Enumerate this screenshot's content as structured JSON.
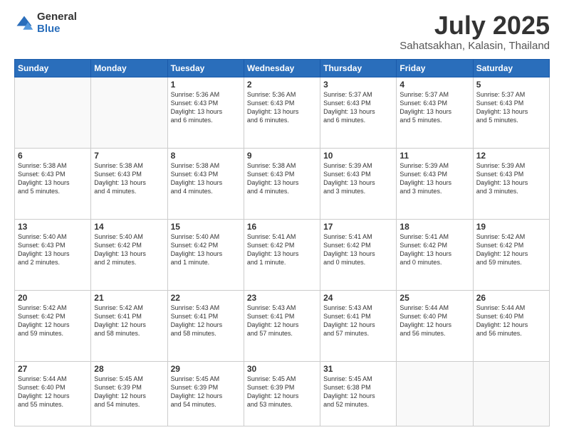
{
  "header": {
    "logo_general": "General",
    "logo_blue": "Blue",
    "title": "July 2025",
    "location": "Sahatsakhan, Kalasin, Thailand"
  },
  "weekdays": [
    "Sunday",
    "Monday",
    "Tuesday",
    "Wednesday",
    "Thursday",
    "Friday",
    "Saturday"
  ],
  "weeks": [
    [
      {
        "day": "",
        "text": ""
      },
      {
        "day": "",
        "text": ""
      },
      {
        "day": "1",
        "text": "Sunrise: 5:36 AM\nSunset: 6:43 PM\nDaylight: 13 hours\nand 6 minutes."
      },
      {
        "day": "2",
        "text": "Sunrise: 5:36 AM\nSunset: 6:43 PM\nDaylight: 13 hours\nand 6 minutes."
      },
      {
        "day": "3",
        "text": "Sunrise: 5:37 AM\nSunset: 6:43 PM\nDaylight: 13 hours\nand 6 minutes."
      },
      {
        "day": "4",
        "text": "Sunrise: 5:37 AM\nSunset: 6:43 PM\nDaylight: 13 hours\nand 5 minutes."
      },
      {
        "day": "5",
        "text": "Sunrise: 5:37 AM\nSunset: 6:43 PM\nDaylight: 13 hours\nand 5 minutes."
      }
    ],
    [
      {
        "day": "6",
        "text": "Sunrise: 5:38 AM\nSunset: 6:43 PM\nDaylight: 13 hours\nand 5 minutes."
      },
      {
        "day": "7",
        "text": "Sunrise: 5:38 AM\nSunset: 6:43 PM\nDaylight: 13 hours\nand 4 minutes."
      },
      {
        "day": "8",
        "text": "Sunrise: 5:38 AM\nSunset: 6:43 PM\nDaylight: 13 hours\nand 4 minutes."
      },
      {
        "day": "9",
        "text": "Sunrise: 5:38 AM\nSunset: 6:43 PM\nDaylight: 13 hours\nand 4 minutes."
      },
      {
        "day": "10",
        "text": "Sunrise: 5:39 AM\nSunset: 6:43 PM\nDaylight: 13 hours\nand 3 minutes."
      },
      {
        "day": "11",
        "text": "Sunrise: 5:39 AM\nSunset: 6:43 PM\nDaylight: 13 hours\nand 3 minutes."
      },
      {
        "day": "12",
        "text": "Sunrise: 5:39 AM\nSunset: 6:43 PM\nDaylight: 13 hours\nand 3 minutes."
      }
    ],
    [
      {
        "day": "13",
        "text": "Sunrise: 5:40 AM\nSunset: 6:43 PM\nDaylight: 13 hours\nand 2 minutes."
      },
      {
        "day": "14",
        "text": "Sunrise: 5:40 AM\nSunset: 6:42 PM\nDaylight: 13 hours\nand 2 minutes."
      },
      {
        "day": "15",
        "text": "Sunrise: 5:40 AM\nSunset: 6:42 PM\nDaylight: 13 hours\nand 1 minute."
      },
      {
        "day": "16",
        "text": "Sunrise: 5:41 AM\nSunset: 6:42 PM\nDaylight: 13 hours\nand 1 minute."
      },
      {
        "day": "17",
        "text": "Sunrise: 5:41 AM\nSunset: 6:42 PM\nDaylight: 13 hours\nand 0 minutes."
      },
      {
        "day": "18",
        "text": "Sunrise: 5:41 AM\nSunset: 6:42 PM\nDaylight: 13 hours\nand 0 minutes."
      },
      {
        "day": "19",
        "text": "Sunrise: 5:42 AM\nSunset: 6:42 PM\nDaylight: 12 hours\nand 59 minutes."
      }
    ],
    [
      {
        "day": "20",
        "text": "Sunrise: 5:42 AM\nSunset: 6:42 PM\nDaylight: 12 hours\nand 59 minutes."
      },
      {
        "day": "21",
        "text": "Sunrise: 5:42 AM\nSunset: 6:41 PM\nDaylight: 12 hours\nand 58 minutes."
      },
      {
        "day": "22",
        "text": "Sunrise: 5:43 AM\nSunset: 6:41 PM\nDaylight: 12 hours\nand 58 minutes."
      },
      {
        "day": "23",
        "text": "Sunrise: 5:43 AM\nSunset: 6:41 PM\nDaylight: 12 hours\nand 57 minutes."
      },
      {
        "day": "24",
        "text": "Sunrise: 5:43 AM\nSunset: 6:41 PM\nDaylight: 12 hours\nand 57 minutes."
      },
      {
        "day": "25",
        "text": "Sunrise: 5:44 AM\nSunset: 6:40 PM\nDaylight: 12 hours\nand 56 minutes."
      },
      {
        "day": "26",
        "text": "Sunrise: 5:44 AM\nSunset: 6:40 PM\nDaylight: 12 hours\nand 56 minutes."
      }
    ],
    [
      {
        "day": "27",
        "text": "Sunrise: 5:44 AM\nSunset: 6:40 PM\nDaylight: 12 hours\nand 55 minutes."
      },
      {
        "day": "28",
        "text": "Sunrise: 5:45 AM\nSunset: 6:39 PM\nDaylight: 12 hours\nand 54 minutes."
      },
      {
        "day": "29",
        "text": "Sunrise: 5:45 AM\nSunset: 6:39 PM\nDaylight: 12 hours\nand 54 minutes."
      },
      {
        "day": "30",
        "text": "Sunrise: 5:45 AM\nSunset: 6:39 PM\nDaylight: 12 hours\nand 53 minutes."
      },
      {
        "day": "31",
        "text": "Sunrise: 5:45 AM\nSunset: 6:38 PM\nDaylight: 12 hours\nand 52 minutes."
      },
      {
        "day": "",
        "text": ""
      },
      {
        "day": "",
        "text": ""
      }
    ]
  ]
}
